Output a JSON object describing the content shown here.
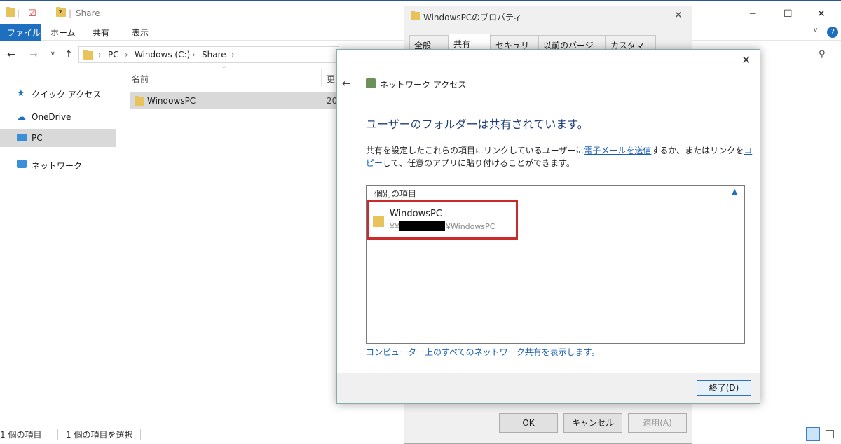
{
  "explorer": {
    "title": "Share",
    "ribbon_tabs": [
      "ファイル",
      "ホーム",
      "共有",
      "表示"
    ],
    "breadcrumb": [
      "PC",
      "Windows (C:)",
      "Share"
    ],
    "sidebar": [
      "クイック アクセス",
      "OneDrive",
      "PC",
      "ネットワーク"
    ],
    "columns": {
      "name": "名前",
      "date": "更"
    },
    "file": {
      "name": "WindowsPC",
      "date": "20"
    },
    "status": {
      "count": "1 個の項目",
      "selected": "1 個の項目を選択"
    }
  },
  "properties": {
    "title": "WindowsPCのプロパティ",
    "tabs": [
      "全般",
      "共有",
      "セキュリティ",
      "以前のバージョン",
      "カスタマイズ"
    ],
    "buttons": {
      "ok": "OK",
      "cancel": "キャンセル",
      "apply": "適用(A)"
    }
  },
  "network_access": {
    "title": "ネットワーク アクセス",
    "heading": "ユーザーのフォルダーは共有されています。",
    "desc_1": "共有を設定したこれらの項目にリンクしているユーザーに",
    "desc_link_email": "電子メールを送信",
    "desc_2": "するか、またはリンクを",
    "desc_link_copy": "コピー",
    "desc_3": "して、任意のアプリに貼り付けることができます。",
    "group_label": "個別の項目",
    "share_item": {
      "name": "WindowsPC",
      "path_prefix": "¥¥",
      "path_suffix": "¥WindowsPC"
    },
    "all_shares_link": "コンピューター上のすべてのネットワーク共有を表示します。",
    "finish_button": "終了(D)"
  }
}
